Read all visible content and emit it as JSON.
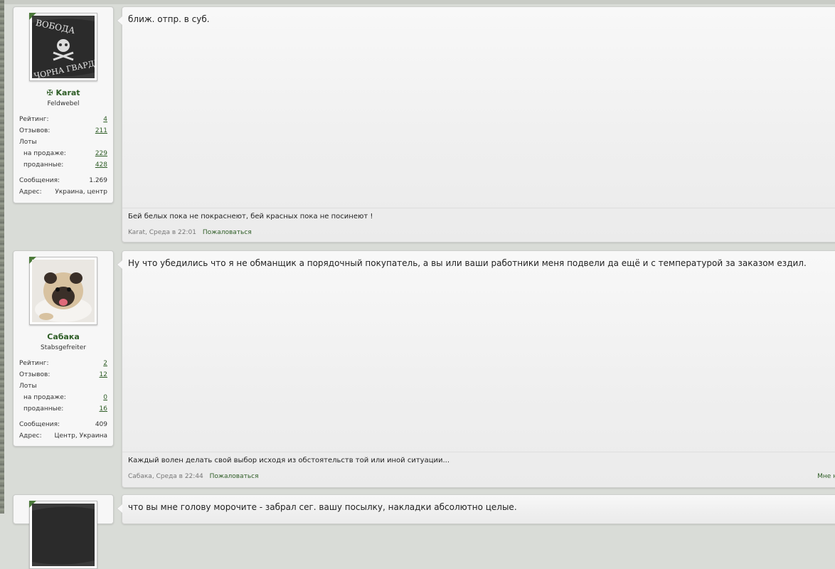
{
  "posts": [
    {
      "user": {
        "name": "Karat",
        "name_prefix": "✠",
        "rank": "Feldwebel",
        "stats": {
          "rating_label": "Рейтинг:",
          "rating": "4",
          "reviews_label": "Отзывов:",
          "reviews": "211",
          "lots_label": "Лоты",
          "on_sale_label": "на продаже:",
          "on_sale": "229",
          "sold_label": "проданные:",
          "sold": "428",
          "messages_label": "Сообщения:",
          "messages": "1.269",
          "address_label": "Адрес:",
          "address": "Украина, центр"
        },
        "avatar_text_top": "ВОБОДА",
        "avatar_text_bottom": "ЧОРНА ГВАРДІЯ"
      },
      "message": "ближ. отпр. в суб.",
      "signature": "Бей белых пока не покраснеют, бей красных пока не посинеют !",
      "meta": "Karat, Среда в 22:01",
      "report": "Пожаловаться"
    },
    {
      "user": {
        "name": "Сабака",
        "rank": "Stabsgefreiter",
        "stats": {
          "rating_label": "Рейтинг:",
          "rating": "2",
          "reviews_label": "Отзывов:",
          "reviews": "12",
          "lots_label": "Лоты",
          "on_sale_label": "на продаже:",
          "on_sale": "0",
          "sold_label": "проданные:",
          "sold": "16",
          "messages_label": "Сообщения:",
          "messages": "409",
          "address_label": "Адрес:",
          "address": "Центр, Украина"
        }
      },
      "message": "Ну что убедились что я не обманщик а порядочный покупатель, а вы или ваши работники меня подвели да ещё и с температурой за заказом ездил.",
      "signature": "Каждый волен делать свой выбор исходя из обстоятельств той или иной ситуации...",
      "meta": "Сабака, Среда в 22:44",
      "report": "Пожаловаться",
      "meta_right": "Мне н"
    },
    {
      "message": "что вы мне голову морочите - забрал сег. вашу посылку, накладки абсолютно целые."
    }
  ],
  "colors": {
    "accent": "#2e5d26",
    "background": "#d9dcd7"
  }
}
